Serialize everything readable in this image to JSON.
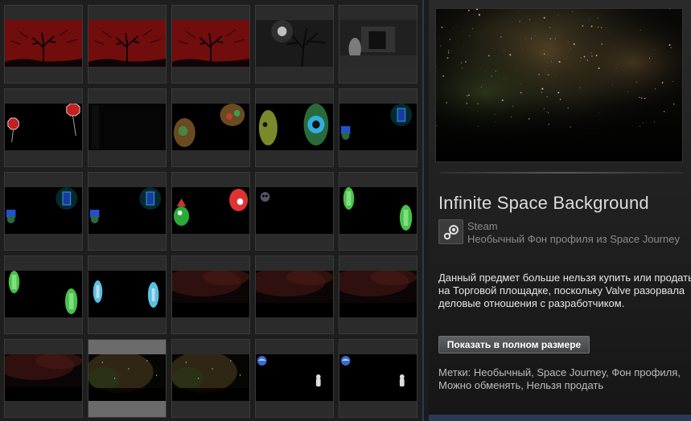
{
  "inventory": {
    "rows": [
      [
        {
          "art": "red-tree",
          "name": "red-tree-background"
        },
        {
          "art": "red-tree",
          "name": "red-tree-background"
        },
        {
          "art": "red-tree",
          "name": "red-tree-background"
        },
        {
          "art": "moon-tree",
          "name": "moon-tree-background"
        },
        {
          "art": "haunted-room",
          "name": "haunted-room-background"
        }
      ],
      [
        {
          "art": "stop-signs",
          "name": "stop-signs-background"
        },
        {
          "art": "dark",
          "name": "dark-background"
        },
        {
          "art": "green-blobs",
          "name": "green-blobs-background"
        },
        {
          "art": "eye-blob",
          "name": "eye-blob-background"
        },
        {
          "art": "blue-portal",
          "name": "blue-portal-background"
        }
      ],
      [
        {
          "art": "blue-portal",
          "name": "blue-portal-background"
        },
        {
          "art": "blue-portal",
          "name": "blue-portal-background"
        },
        {
          "art": "green-creature",
          "name": "green-creature-background"
        },
        {
          "art": "skull",
          "name": "skull-background"
        },
        {
          "art": "green-doors",
          "name": "green-doors-background"
        }
      ],
      [
        {
          "art": "green-doors",
          "name": "green-doors-background"
        },
        {
          "art": "cyan-doors",
          "name": "cyan-doors-background"
        },
        {
          "art": "red-space",
          "name": "red-space-background"
        },
        {
          "art": "red-space",
          "name": "red-space-background"
        },
        {
          "art": "red-space",
          "name": "red-space-background"
        }
      ],
      [
        {
          "art": "red-space",
          "name": "red-space-background"
        },
        {
          "art": "gold-space",
          "name": "infinite-space-background",
          "selected": true
        },
        {
          "art": "gold-space",
          "name": "infinite-space-background"
        },
        {
          "art": "earth-astronaut",
          "name": "earth-astronaut-background"
        },
        {
          "art": "earth-astronaut",
          "name": "earth-astronaut-background"
        }
      ]
    ]
  },
  "detail": {
    "title": "Infinite Space Background",
    "app_name": "Steam",
    "item_type": "Необычный Фон профиля из Space Journey",
    "description": "Данный предмет больше нельзя купить или продать на Торговой площадке, поскольку Valve разорвала деловые отношения с разработчиком.",
    "view_full_button": "Показать в полном размере",
    "tags_label": "Метки:",
    "tags": "Необычный, Space Journey, Фон профиля, Можно обменять, Нельзя продать"
  },
  "icons": {
    "app": "steam-icon"
  }
}
